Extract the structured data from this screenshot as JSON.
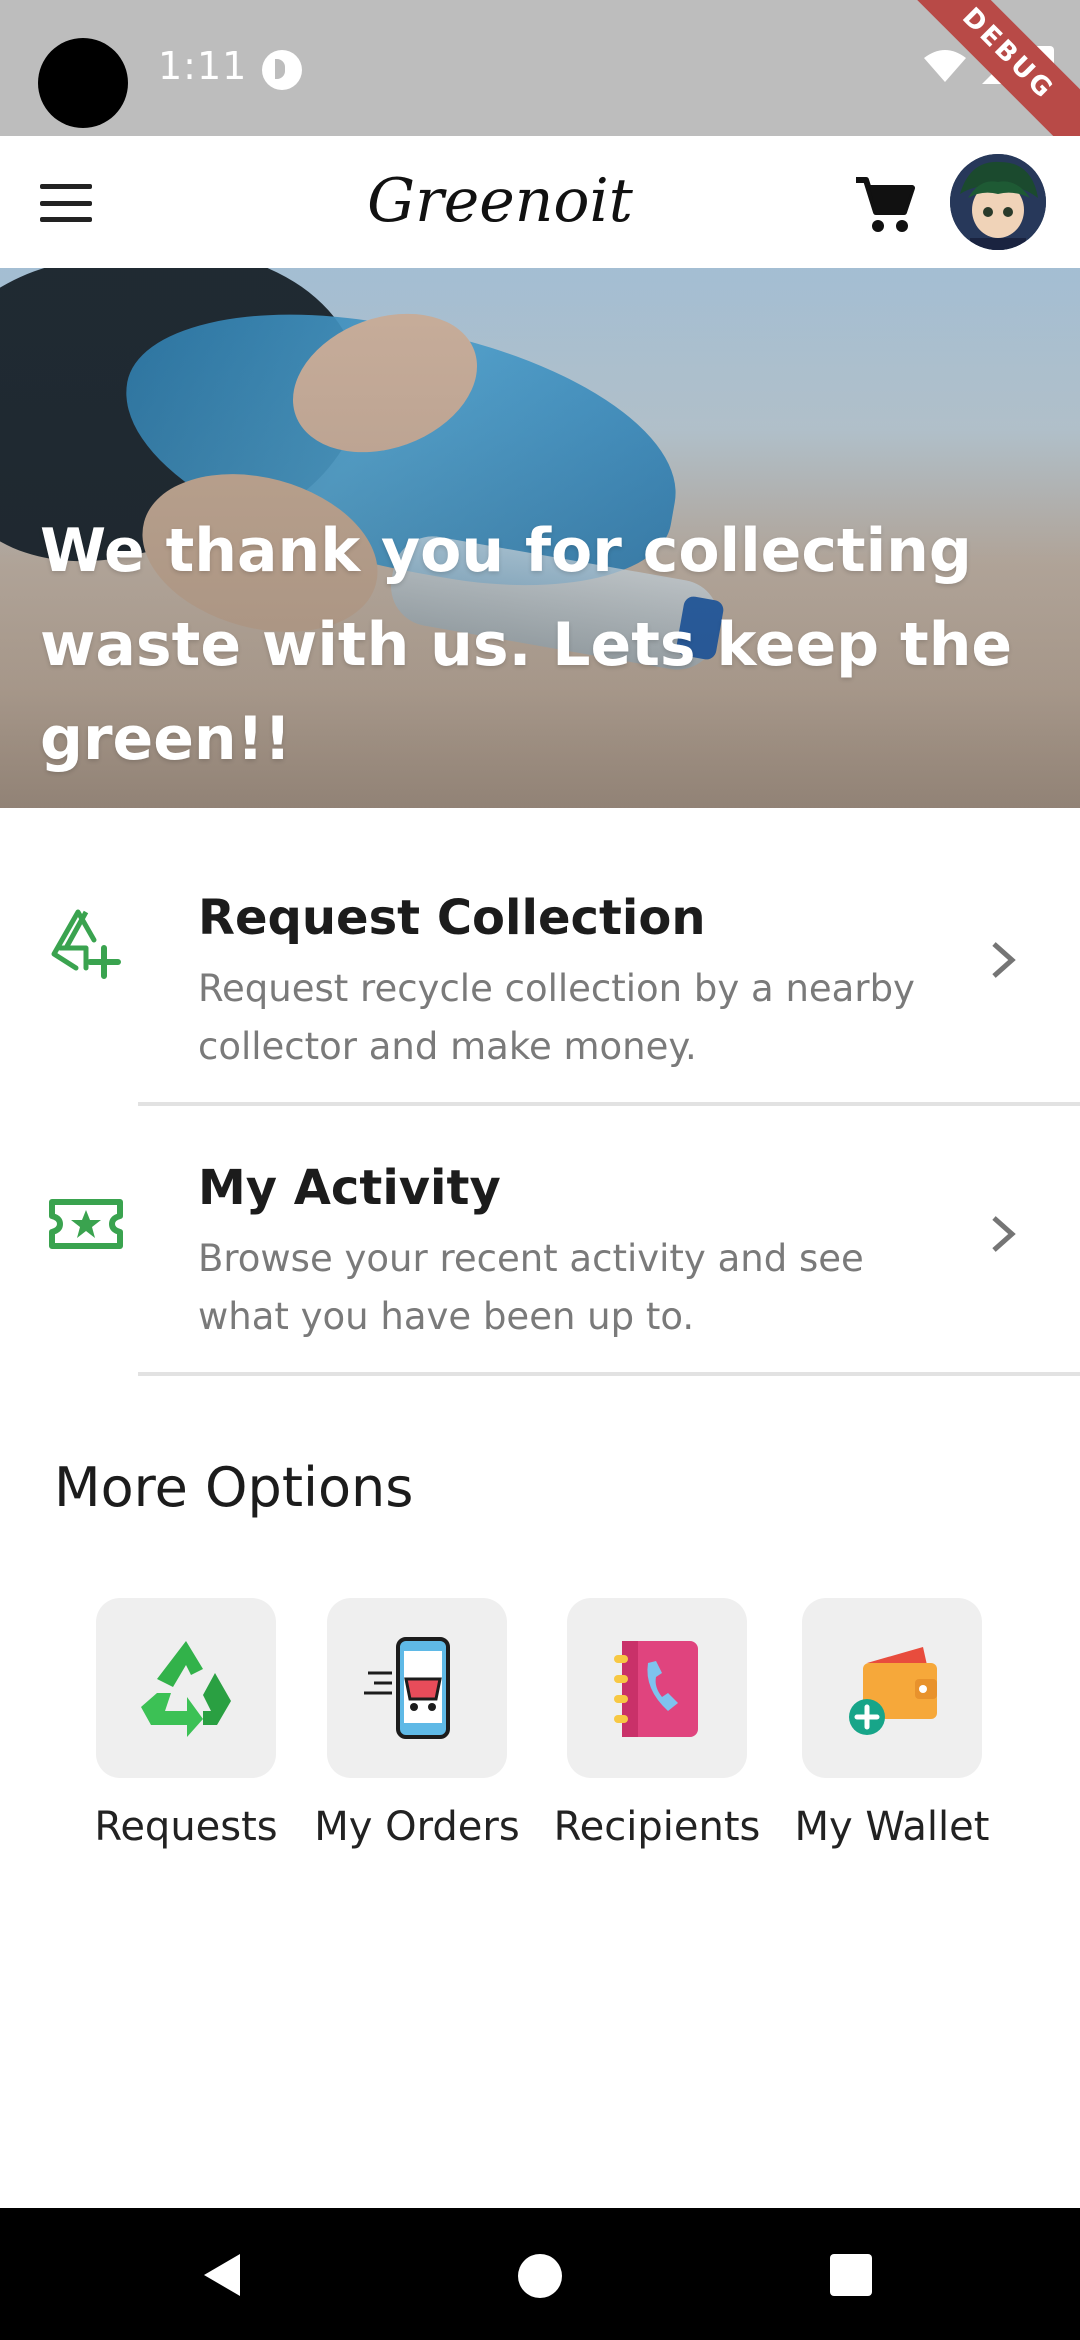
{
  "status_bar": {
    "time": "1:11",
    "debug_label": "DEBUG"
  },
  "app_bar": {
    "title": "Greenoit",
    "icons": [
      "menu-icon",
      "cart-icon",
      "avatar"
    ]
  },
  "hero": {
    "message": "We thank you for collecting waste with us. Lets keep the green!!"
  },
  "actions": [
    {
      "title": "Request Collection",
      "description": "Request recycle collection by a nearby collector and make money.",
      "icon": "recycle-plus-icon"
    },
    {
      "title": "My Activity",
      "description": "Browse your recent activity and see what you have been up to.",
      "icon": "ticket-star-icon"
    }
  ],
  "more_options": {
    "title": "More Options",
    "items": [
      {
        "label": "Requests",
        "icon": "recycle-icon"
      },
      {
        "label": "My Orders",
        "icon": "phone-cart-icon"
      },
      {
        "label": "Recipients",
        "icon": "contacts-book-icon"
      },
      {
        "label": "My Wallet",
        "icon": "wallet-add-icon"
      }
    ]
  },
  "colors": {
    "accent_green": "#3aa34f",
    "status_bar": "#bdbdbd",
    "debug_ribbon": "#b84a47"
  }
}
